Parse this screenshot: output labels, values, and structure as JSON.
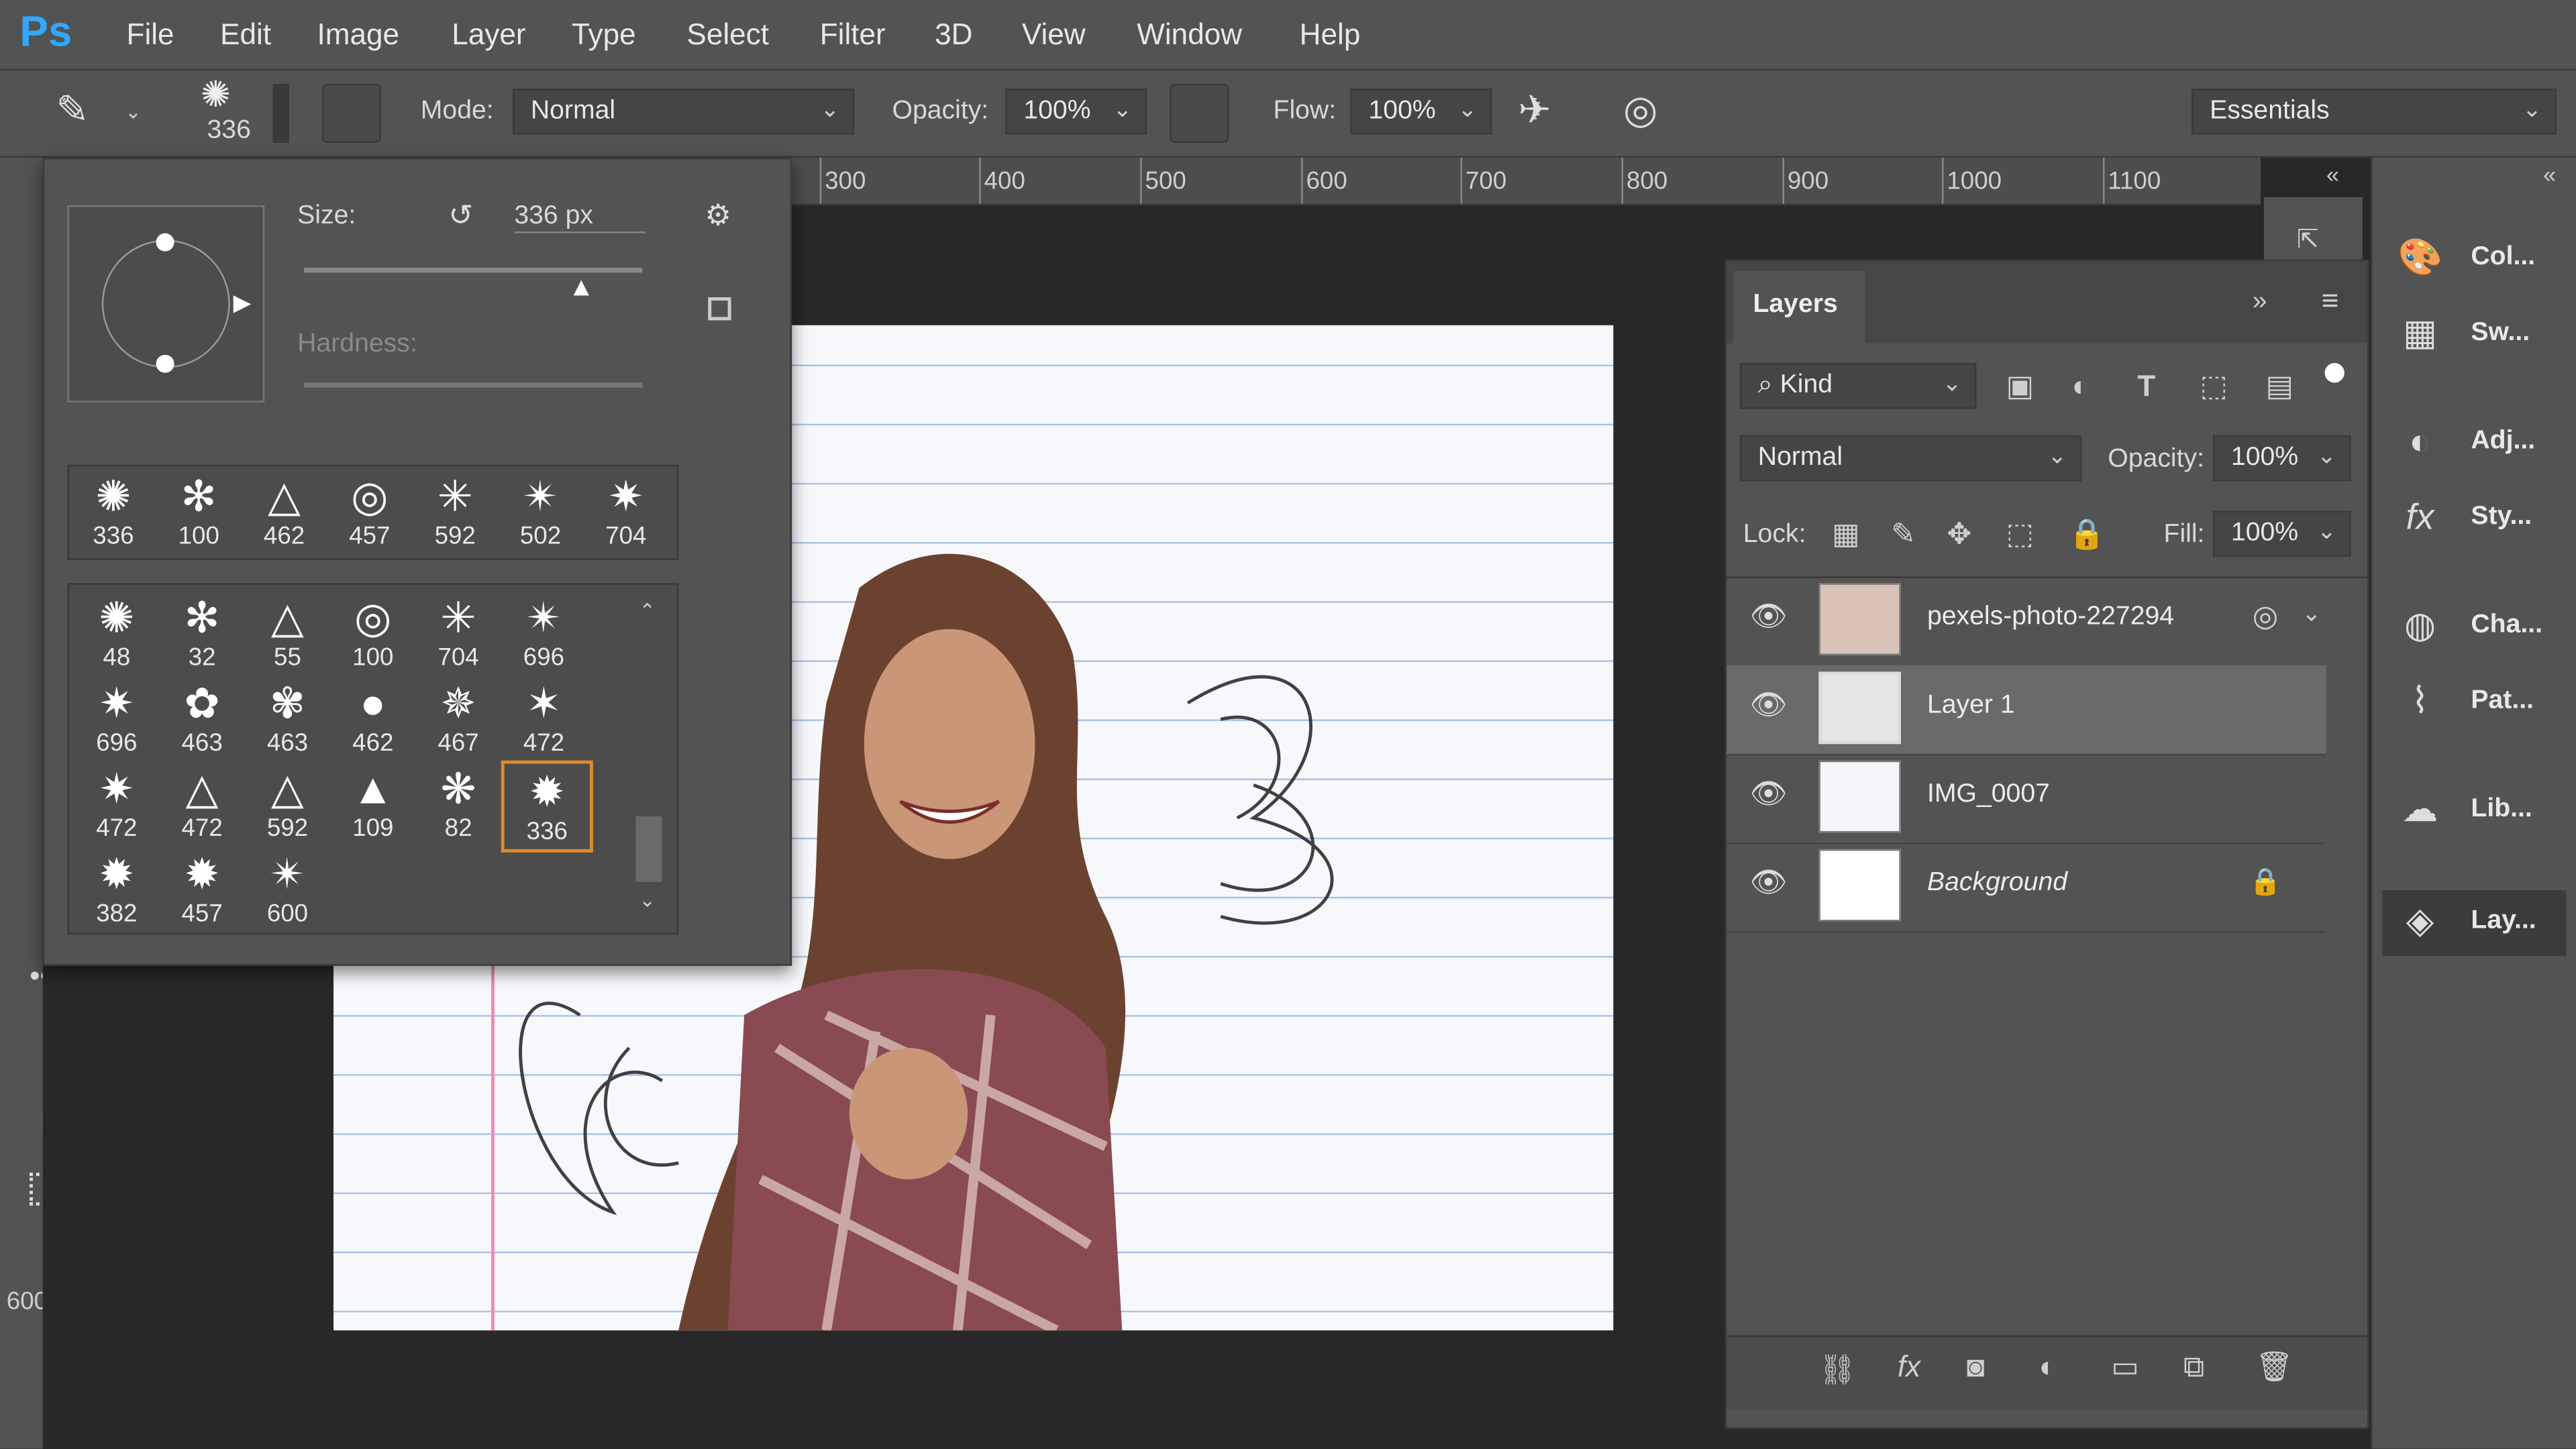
{
  "app": {
    "logo": "Ps"
  },
  "menu": [
    "File",
    "Edit",
    "Image",
    "Layer",
    "Type",
    "Select",
    "Filter",
    "3D",
    "View",
    "Window",
    "Help"
  ],
  "options": {
    "brush_size": "336",
    "mode_label": "Mode:",
    "mode_value": "Normal",
    "opacity_label": "Opacity:",
    "opacity_value": "100%",
    "flow_label": "Flow:",
    "flow_value": "100%",
    "workspace": "Essentials"
  },
  "ruler": [
    "300",
    "400",
    "500",
    "600",
    "700",
    "800",
    "900",
    "1000",
    "1100"
  ],
  "brush_panel": {
    "size_label": "Size:",
    "size_value": "336 px",
    "hardness_label": "Hardness:",
    "size_slider_fraction": 0.82,
    "recent": [
      "336",
      "100",
      "462",
      "457",
      "592",
      "502",
      "704"
    ],
    "presets": [
      "48",
      "32",
      "55",
      "100",
      "704",
      "696",
      "696",
      "463",
      "463",
      "462",
      "467",
      "472",
      "472",
      "472",
      "592",
      "109",
      "82",
      "336",
      "382",
      "457",
      "600"
    ],
    "selected_preset": "336"
  },
  "layers_panel": {
    "title": "Layers",
    "filter_kind": "Kind",
    "blend_mode": "Normal",
    "opacity_label": "Opacity:",
    "opacity_value": "100%",
    "lock_label": "Lock:",
    "fill_label": "Fill:",
    "fill_value": "100%",
    "layers": [
      {
        "name": "pexels-photo-227294",
        "visible": true,
        "selected": false
      },
      {
        "name": "Layer 1",
        "visible": true,
        "selected": true
      },
      {
        "name": "IMG_0007",
        "visible": true,
        "selected": false
      },
      {
        "name": "Background",
        "visible": true,
        "selected": false,
        "locked": true
      }
    ]
  },
  "dock": [
    "Col...",
    "Sw...",
    "Adj...",
    "Sty...",
    "Cha...",
    "Pat...",
    "Lib...",
    "Lay..."
  ],
  "side_ruler": "600",
  "colors": {
    "accent": "#31a8ff",
    "panel": "#535353",
    "selected_border": "#e08a2c"
  }
}
